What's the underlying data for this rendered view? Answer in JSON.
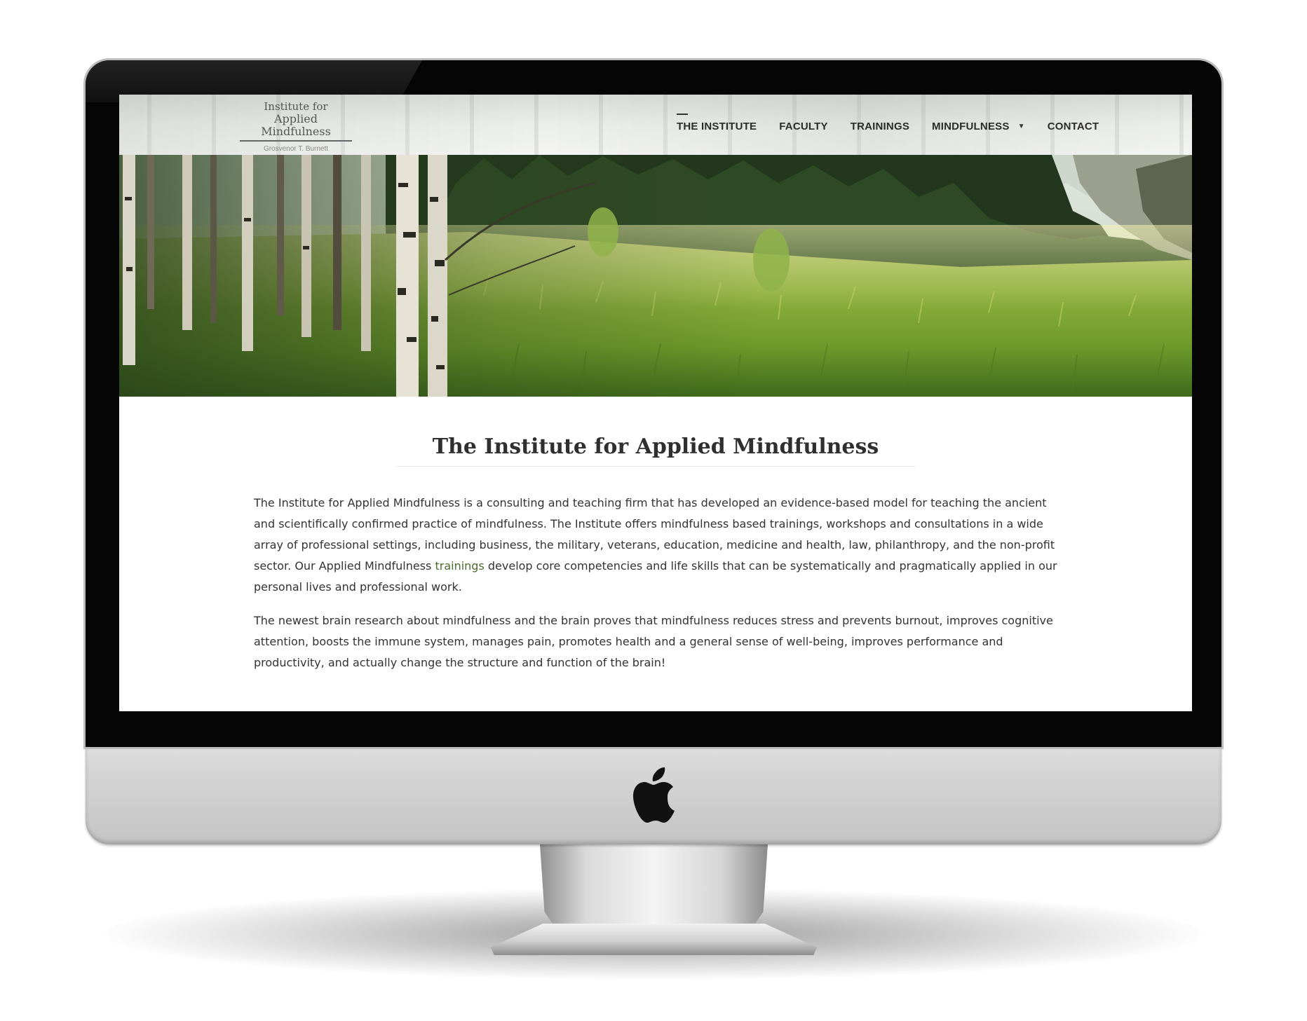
{
  "site": {
    "logo": {
      "line1": "Institute for",
      "line2": "Applied Mindfulness",
      "line3": "Grosvenor T. Burnett"
    },
    "nav": [
      {
        "label": "THE INSTITUTE",
        "active": true
      },
      {
        "label": "FACULTY"
      },
      {
        "label": "TRAININGS"
      },
      {
        "label": "MINDFULNESS",
        "has_dropdown": true
      },
      {
        "label": "CONTACT"
      }
    ],
    "hero_image": "forest-meadow-photo"
  },
  "main": {
    "title": "The Institute for Applied Mindfulness",
    "paragraph1": {
      "before_link": "The Institute for Applied Mindfulness is a consulting and teaching firm that has developed an evidence-based model for teaching the ancient and scientifically confirmed practice of mindfulness. The Institute offers mindfulness based trainings, workshops and consultations in a wide array of professional settings, including business, the military, veterans, education, medicine and health, law, philanthropy, and the non-profit sector.  Our Applied Mindfulness ",
      "link": "trainings",
      "after_link": " develop core competencies and life skills that can be systematically and pragmatically applied in our personal lives and professional work."
    },
    "paragraph2": "The newest brain research about mindfulness and the brain proves that mindfulness reduces stress and prevents burnout, improves cognitive attention, boosts the immune system, manages pain, promotes health and a general sense of well-being, improves performance and productivity, and actually change the structure and function of the brain!"
  },
  "device": {
    "logo_icon": "apple-logo-icon"
  },
  "colors": {
    "link": "#4c6b2f",
    "text": "#333333",
    "bezel": "#050505",
    "aluminum": "#d6d6d6"
  }
}
